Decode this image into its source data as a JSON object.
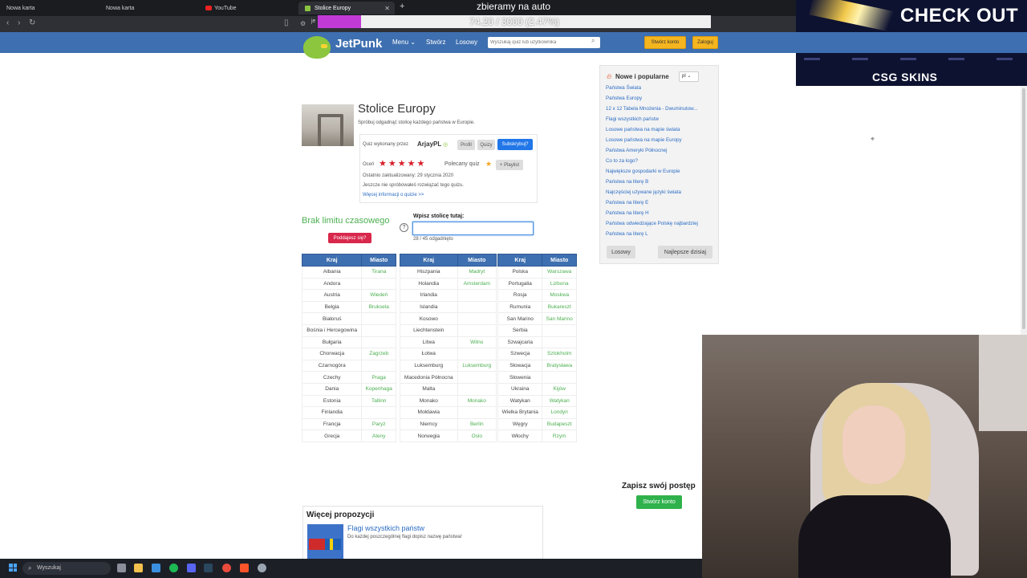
{
  "browser": {
    "tabs": [
      {
        "label": "Nowa karta"
      },
      {
        "label": "Nowa karta"
      },
      {
        "label": "YouTube"
      },
      {
        "label": "Stolice Europy"
      }
    ],
    "url_fragment": "je"
  },
  "stream": {
    "title": "zbieramy na auto",
    "progress_text": "74.20 / 3000 (2.47%)",
    "progress_fraction": 0.0247,
    "sponsor_headline": "CHECK OUT",
    "sponsor_brand": "CSG SKINS"
  },
  "header": {
    "logo": "JetPunk",
    "nav": [
      "Menu",
      "Stwórz",
      "Losowy"
    ],
    "search_placeholder": "Wyszukaj quiz lub użytkownika",
    "create_account": "Stwórz konto",
    "login": "Zaloguj"
  },
  "quiz": {
    "title": "Stolice Europy",
    "description": "Spróbuj odgadnąć stolicę każdego państwa w Europie.",
    "made_by_label": "Quiz wykonany przez",
    "author": "ArjayPL",
    "profile_btn": "Profil",
    "quizzes_btn": "Quizy",
    "subscribe_btn": "Subskrybuj?",
    "rate_label": "Oceń",
    "recommended_label": "Polecany quiz",
    "playlist_btn": "+ Playlist",
    "updated": "Ostatnio zaktualizowany: 29 stycznia 2020",
    "not_tried": "Jeszcze nie spróbowałeś rozwiązać tego quizu.",
    "more_info": "Więcej informacji o quizie >>",
    "no_limit": "Brak limitu czasowego",
    "give_up": "Poddajesz się?",
    "answer_label": "Wpisz stolicę tutaj:",
    "score": "28 / 45 odgadnięto"
  },
  "tables": {
    "col_country": "Kraj",
    "col_capital": "Miasto",
    "t1": [
      [
        "Albania",
        "Tirana"
      ],
      [
        "Andora",
        ""
      ],
      [
        "Austria",
        "Wiedeń"
      ],
      [
        "Belgia",
        "Bruksela"
      ],
      [
        "Białoruś",
        ""
      ],
      [
        "Bośnia i Hercegowina",
        ""
      ],
      [
        "Bułgaria",
        ""
      ],
      [
        "Chorwacja",
        "Zagrzeb"
      ],
      [
        "Czarnogóra",
        ""
      ],
      [
        "Czechy",
        "Praga"
      ],
      [
        "Dania",
        "Kopenhaga"
      ],
      [
        "Estonia",
        "Tallinn"
      ],
      [
        "Finlandia",
        ""
      ],
      [
        "Francja",
        "Paryż"
      ],
      [
        "Grecja",
        "Ateny"
      ]
    ],
    "t2": [
      [
        "Hiszpania",
        "Madryt"
      ],
      [
        "Holandia",
        "Amsterdam"
      ],
      [
        "Irlandia",
        ""
      ],
      [
        "Islandia",
        ""
      ],
      [
        "Kosowo",
        ""
      ],
      [
        "Liechtenstein",
        ""
      ],
      [
        "Litwa",
        "Wilno"
      ],
      [
        "Łotwa",
        ""
      ],
      [
        "Luksemburg",
        "Luksemburg"
      ],
      [
        "Macedonia Północna",
        ""
      ],
      [
        "Malta",
        ""
      ],
      [
        "Monako",
        "Monako"
      ],
      [
        "Mołdawia",
        ""
      ],
      [
        "Niemcy",
        "Berlin"
      ],
      [
        "Norwegia",
        "Oslo"
      ]
    ],
    "t3": [
      [
        "Polska",
        "Warszawa"
      ],
      [
        "Portugalia",
        "Lizbona"
      ],
      [
        "Rosja",
        "Moskwa"
      ],
      [
        "Rumunia",
        "Bukareszt"
      ],
      [
        "San Marino",
        "San Marino"
      ],
      [
        "Serbia",
        ""
      ],
      [
        "Szwajcaria",
        ""
      ],
      [
        "Szwecja",
        "Sztokholm"
      ],
      [
        "Słowacja",
        "Bratysława"
      ],
      [
        "Słowenia",
        ""
      ],
      [
        "Ukraina",
        "Kijów"
      ],
      [
        "Watykan",
        "Watykan"
      ],
      [
        "Wielka Brytania",
        "Londyn"
      ],
      [
        "Węgry",
        "Budapeszt"
      ],
      [
        "Włochy",
        "Rzym"
      ]
    ]
  },
  "sidebar": {
    "title": "Nowe i popularne",
    "lang": "pl",
    "links": [
      "Państwa Świata",
      "Państwa Europy",
      "12 x 12 Tabela Mnożenia - Dwuminutow...",
      "Flagi wszystkich państw",
      "Losowe państwa na mapie świata",
      "Losowe państwa na mapie Europy",
      "Państwa Ameryki Północnej",
      "Co to za logo?",
      "Największe gospodarki w Europie",
      "Państwa na literę B",
      "Najczęściej używane języki świata",
      "Państwa na literę E",
      "Państwa na literę H",
      "Państwa odwiedzające Polskę najbardziej",
      "Państwa na literę L"
    ],
    "random_btn": "Losowy",
    "best_btn": "Najlepsze dzisiaj"
  },
  "save": {
    "title": "Zapisz swój postęp",
    "button": "Stwórz konto"
  },
  "more": {
    "title": "Więcej propozycji",
    "link": "Flagi wszystkich państw",
    "desc": "Do każdej poszczególnej flagi dopisz nazwę państwa!"
  },
  "taskbar": {
    "search": "Wyszukaj"
  },
  "colors": {
    "jetpunk_blue": "#3e6fb0",
    "correct_green": "#4caf50",
    "progress_purple": "#c23ad6"
  }
}
